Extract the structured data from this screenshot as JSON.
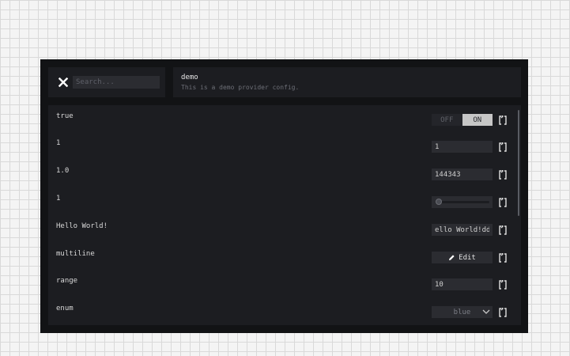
{
  "search": {
    "placeholder": "Search..."
  },
  "provider": {
    "name": "demo",
    "description": "This is a demo provider config."
  },
  "rows": [
    {
      "label": "true",
      "control": "toggle",
      "off_label": "OFF",
      "on_label": "ON",
      "state": "on"
    },
    {
      "label": "1",
      "control": "number",
      "value": "1"
    },
    {
      "label": "1.0",
      "control": "number",
      "value": "144343"
    },
    {
      "label": "1",
      "control": "slider",
      "level": 0
    },
    {
      "label": "Hello World!",
      "control": "text",
      "value": "ello World!ddas"
    },
    {
      "label": "multiline",
      "control": "edit",
      "button_label": "Edit"
    },
    {
      "label": "range",
      "control": "number",
      "value": "10"
    },
    {
      "label": "enum",
      "control": "select",
      "value": "blue"
    }
  ],
  "colors": {
    "window_bg": "#121315",
    "panel_bg": "#1c1d21",
    "control_bg": "#2b2c31",
    "toggle_on": "#c6c6c6"
  },
  "icons": {
    "close": "close-icon",
    "reset": "reset-icon",
    "edit": "pencil-icon",
    "dropdown": "chevron-down-icon"
  }
}
